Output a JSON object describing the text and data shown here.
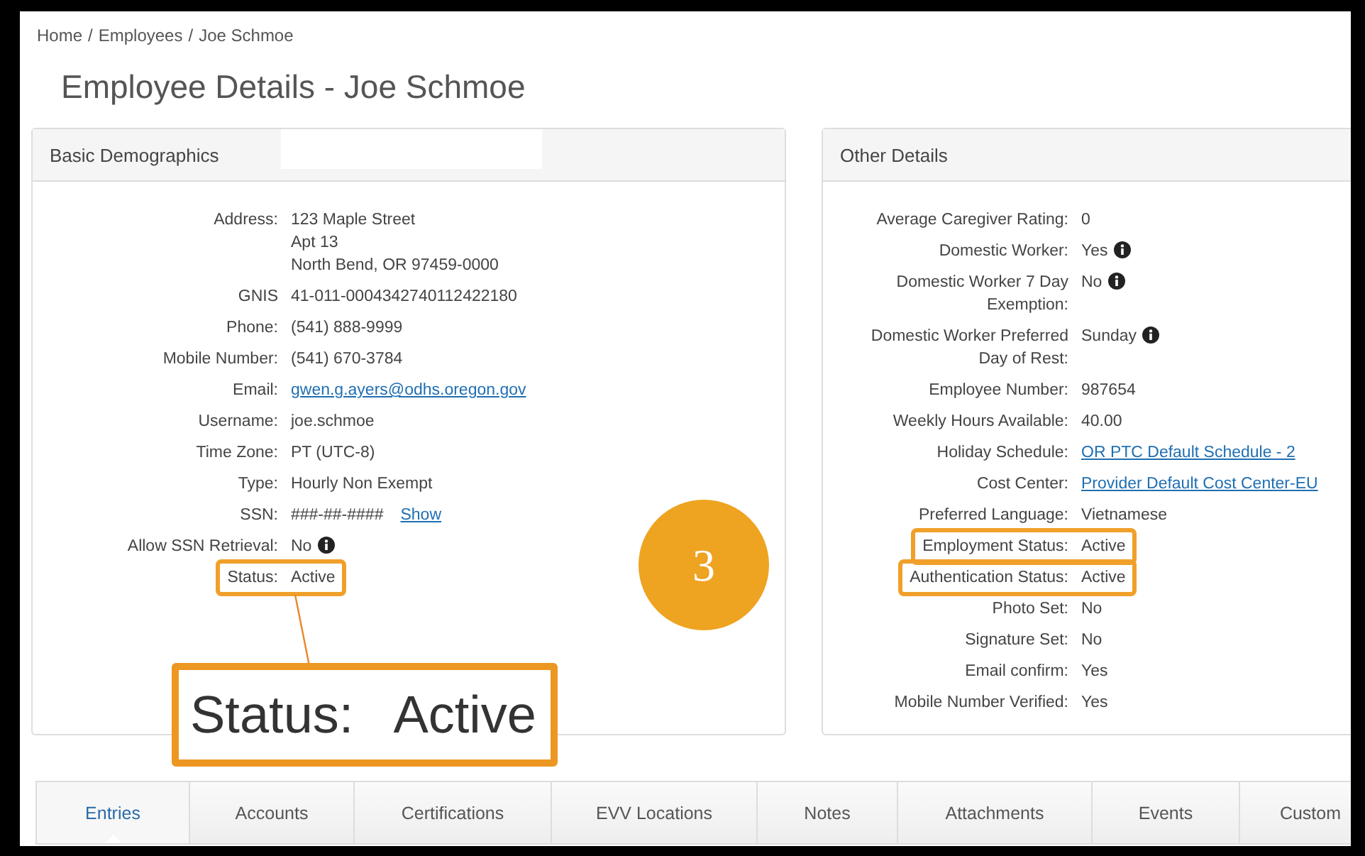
{
  "breadcrumb": [
    {
      "label": "Home"
    },
    {
      "label": "Employees"
    },
    {
      "label": "Joe Schmoe"
    }
  ],
  "breadcrumb_separator": "/",
  "title": "Employee Details - Joe Schmoe",
  "panels": [
    {
      "title": "Basic Demographics",
      "redacted_header": true,
      "rows": [
        {
          "label": "Address:",
          "values": [
            "123 Maple Street",
            "Apt 13",
            "North Bend, OR 97459-0000"
          ],
          "kind": "text",
          "info": false,
          "highlighted": false
        },
        {
          "label": "GNIS",
          "values": [
            "41-011-0004342740112422180"
          ],
          "kind": "text",
          "info": false,
          "highlighted": false
        },
        {
          "label": "Phone:",
          "values": [
            "(541) 888-9999"
          ],
          "kind": "text",
          "info": false,
          "highlighted": false
        },
        {
          "label": "Mobile Number:",
          "values": [
            "(541) 670-3784"
          ],
          "kind": "text",
          "info": false,
          "highlighted": false
        },
        {
          "label": "Email:",
          "values": [
            "gwen.g.ayers@odhs.oregon.gov"
          ],
          "kind": "link",
          "info": false,
          "highlighted": false
        },
        {
          "label": "Username:",
          "values": [
            "joe.schmoe"
          ],
          "kind": "text",
          "info": false,
          "highlighted": false
        },
        {
          "label": "Time Zone:",
          "values": [
            "PT (UTC-8)"
          ],
          "kind": "text",
          "info": false,
          "highlighted": false
        },
        {
          "label": "Type:",
          "values": [
            "Hourly Non Exempt"
          ],
          "kind": "text",
          "info": false,
          "highlighted": false
        },
        {
          "label": "SSN:",
          "values": [
            "###-##-####"
          ],
          "action": "Show",
          "kind": "text",
          "info": false,
          "highlighted": false
        },
        {
          "label": "Allow SSN Retrieval:",
          "values": [
            "No"
          ],
          "kind": "text",
          "info": true,
          "highlighted": false
        },
        {
          "label": "Status:",
          "values": [
            "Active"
          ],
          "kind": "text",
          "info": false,
          "highlighted": true
        }
      ]
    },
    {
      "title": "Other Details",
      "redacted_header": false,
      "rows": [
        {
          "label": "Average Caregiver Rating:",
          "values": [
            "0"
          ],
          "kind": "text",
          "info": false,
          "highlighted": false
        },
        {
          "label": "Domestic Worker:",
          "values": [
            "Yes"
          ],
          "kind": "text",
          "info": true,
          "highlighted": false
        },
        {
          "label": "Domestic Worker 7 Day Exemption:",
          "values": [
            "No"
          ],
          "kind": "text",
          "info": true,
          "highlighted": false
        },
        {
          "label": "Domestic Worker Preferred Day of Rest:",
          "values": [
            "Sunday"
          ],
          "kind": "text",
          "info": true,
          "highlighted": false
        },
        {
          "label": "Employee Number:",
          "values": [
            "987654"
          ],
          "kind": "text",
          "info": false,
          "highlighted": false
        },
        {
          "label": "Weekly Hours Available:",
          "values": [
            "40.00"
          ],
          "kind": "text",
          "info": false,
          "highlighted": false
        },
        {
          "label": "Holiday Schedule:",
          "values": [
            "OR PTC Default Schedule - 2"
          ],
          "kind": "link",
          "info": false,
          "highlighted": false
        },
        {
          "label": "Cost Center:",
          "values": [
            "Provider Default Cost Center-EU"
          ],
          "kind": "link",
          "info": false,
          "highlighted": false
        },
        {
          "label": "Preferred Language:",
          "values": [
            "Vietnamese"
          ],
          "kind": "text",
          "info": false,
          "highlighted": false
        },
        {
          "label": "Employment Status:",
          "values": [
            "Active"
          ],
          "kind": "text",
          "info": false,
          "highlighted": true
        },
        {
          "label": "Authentication Status:",
          "values": [
            "Active"
          ],
          "kind": "text",
          "info": false,
          "highlighted": true
        },
        {
          "label": "Photo Set:",
          "values": [
            "No"
          ],
          "kind": "text",
          "info": false,
          "highlighted": false
        },
        {
          "label": "Signature Set:",
          "values": [
            "No"
          ],
          "kind": "text",
          "info": false,
          "highlighted": false
        },
        {
          "label": "Email confirm:",
          "values": [
            "Yes"
          ],
          "kind": "text",
          "info": false,
          "highlighted": false
        },
        {
          "label": "Mobile Number Verified:",
          "values": [
            "Yes"
          ],
          "kind": "text",
          "info": false,
          "highlighted": false
        }
      ]
    }
  ],
  "callout": {
    "label": "Status:",
    "value": "Active"
  },
  "step_badge": "3",
  "tabs": [
    {
      "label": "Entries",
      "selected": true
    },
    {
      "label": "Accounts",
      "selected": false
    },
    {
      "label": "Certifications",
      "selected": false
    },
    {
      "label": "EVV Locations",
      "selected": false
    },
    {
      "label": "Notes",
      "selected": false
    },
    {
      "label": "Attachments",
      "selected": false
    },
    {
      "label": "Events",
      "selected": false
    },
    {
      "label": "Custom",
      "selected": false
    }
  ]
}
